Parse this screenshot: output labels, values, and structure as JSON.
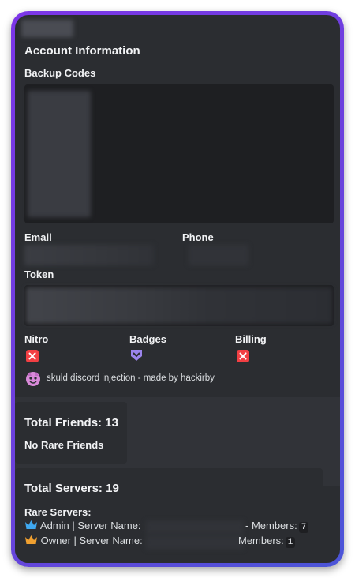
{
  "account": {
    "heading": "Account Information",
    "backup_codes_label": "Backup Codes",
    "email_label": "Email",
    "phone_label": "Phone",
    "token_label": "Token",
    "nitro_label": "Nitro",
    "badges_label": "Badges",
    "billing_label": "Billing",
    "nitro_icon": "red-x-icon",
    "badges_icon": "hypesquad-badge-icon",
    "billing_icon": "red-x-icon",
    "footer_text": "skuld discord injection - made by hackirby"
  },
  "friends": {
    "total": "Total Friends: 13",
    "rare": "No Rare Friends"
  },
  "servers": {
    "total": "Total Servers: 19",
    "rare_label": "Rare Servers:",
    "rows": [
      {
        "icon": "crown-blue-icon",
        "role_label": "Admin | Server Name:",
        "members_label": "- Members:",
        "members": "7"
      },
      {
        "icon": "crown-gold-icon",
        "role_label": "Owner | Server Name:",
        "members_label": "Members:",
        "members": "1"
      }
    ]
  },
  "colors": {
    "frame_gradient_start": "#7c35e8",
    "frame_gradient_end": "#4b55d8",
    "embed_bg": "#2b2d31",
    "code_bg": "#1e1f22",
    "nitro_red": "#f23f43",
    "badge_purple": "#9b84ec"
  }
}
